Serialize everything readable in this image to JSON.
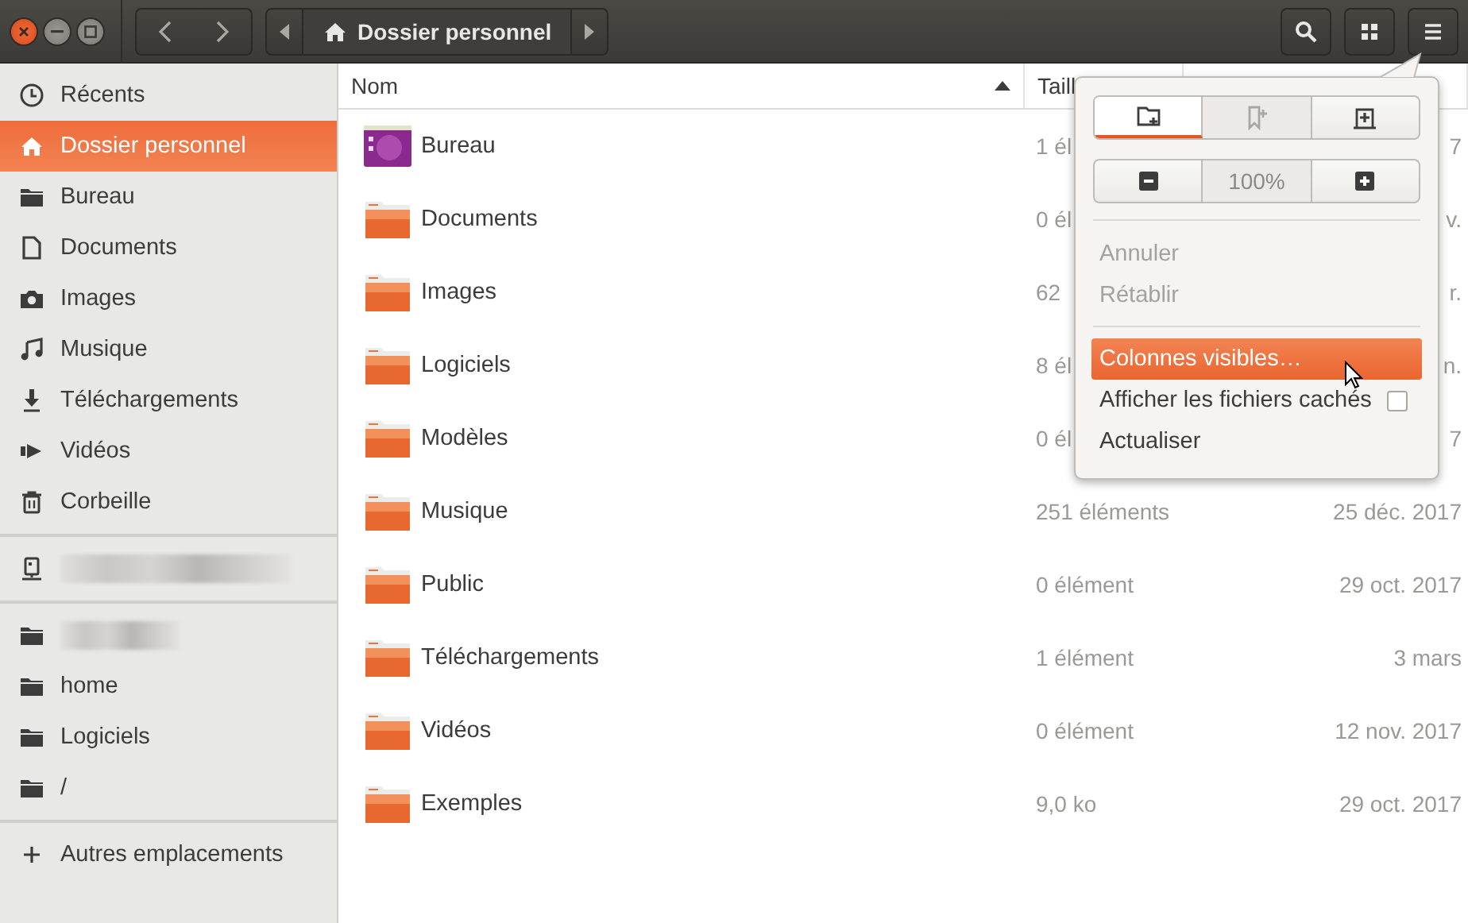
{
  "path_bar": {
    "location": "Dossier personnel"
  },
  "sidebar": {
    "sections": [
      [
        {
          "kind": "recent",
          "label": "Récents",
          "selected": false
        },
        {
          "kind": "home",
          "label": "Dossier personnel",
          "selected": true
        },
        {
          "kind": "folder",
          "label": "Bureau",
          "selected": false
        },
        {
          "kind": "document",
          "label": "Documents",
          "selected": false
        },
        {
          "kind": "camera",
          "label": "Images",
          "selected": false
        },
        {
          "kind": "music",
          "label": "Musique",
          "selected": false
        },
        {
          "kind": "download",
          "label": "Téléchargements",
          "selected": false
        },
        {
          "kind": "video",
          "label": "Vidéos",
          "selected": false
        },
        {
          "kind": "trash",
          "label": "Corbeille",
          "selected": false
        }
      ],
      [
        {
          "kind": "drive",
          "redacted": true,
          "selected": false
        }
      ],
      [
        {
          "kind": "folder",
          "redacted": true,
          "selected": false
        },
        {
          "kind": "folder",
          "label": "home",
          "selected": false
        },
        {
          "kind": "folder",
          "label": "Logiciels",
          "selected": false
        },
        {
          "kind": "folder",
          "label": "/",
          "selected": false
        }
      ],
      [
        {
          "kind": "plus",
          "label": "Autres emplacements",
          "selected": false
        }
      ]
    ]
  },
  "table": {
    "columns": [
      "Nom",
      "Taill"
    ],
    "rows": [
      {
        "kind": "desktop",
        "name": "Bureau",
        "size": "1 él",
        "modified": "7"
      },
      {
        "kind": "folder",
        "name": "Documents",
        "size": "0 él",
        "modified": "v."
      },
      {
        "kind": "folder",
        "name": "Images",
        "size": "62",
        "modified": "r."
      },
      {
        "kind": "folder",
        "name": "Logiciels",
        "size": "8 él",
        "modified": "n."
      },
      {
        "kind": "folder",
        "name": "Modèles",
        "size": "0 él",
        "modified": "7"
      },
      {
        "kind": "folder",
        "name": "Musique",
        "size": "251 éléments",
        "modified": "25 déc. 2017"
      },
      {
        "kind": "folder",
        "name": "Public",
        "size": "0 élément",
        "modified": "29 oct. 2017"
      },
      {
        "kind": "folder",
        "name": "Téléchargements",
        "size": "1 élément",
        "modified": "3 mars"
      },
      {
        "kind": "folder",
        "name": "Vidéos",
        "size": "0 élément",
        "modified": "12 nov. 2017"
      },
      {
        "kind": "folder",
        "name": "Exemples",
        "size": "9,0 ko",
        "modified": "29 oct. 2017"
      }
    ]
  },
  "menu": {
    "zoom": "100%",
    "items": [
      {
        "kind": "action",
        "label": "Annuler",
        "disabled": true,
        "selected": false
      },
      {
        "kind": "action",
        "label": "Rétablir",
        "disabled": true,
        "selected": false
      },
      {
        "kind": "separator"
      },
      {
        "kind": "action",
        "label": "Colonnes visibles…",
        "disabled": false,
        "selected": true
      },
      {
        "kind": "check",
        "label": "Afficher les fichiers cachés",
        "disabled": false,
        "selected": false,
        "checked": false
      },
      {
        "kind": "action",
        "label": "Actualiser",
        "disabled": false,
        "selected": false
      }
    ]
  }
}
